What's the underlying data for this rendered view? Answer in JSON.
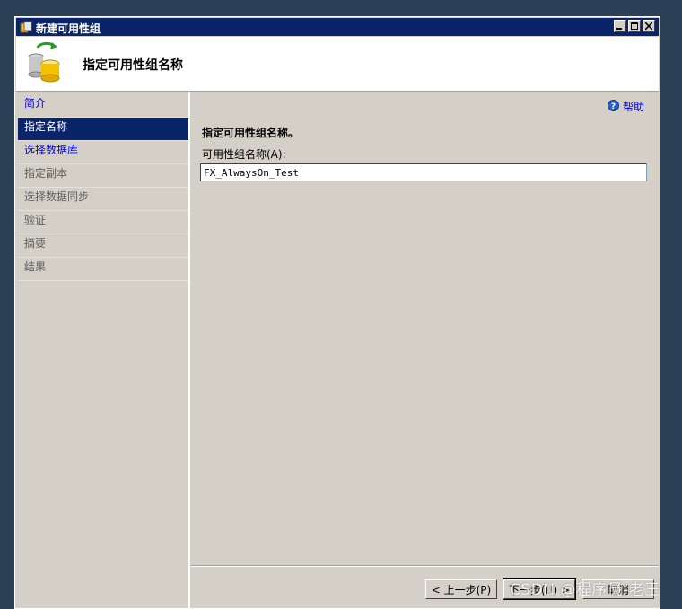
{
  "window": {
    "title": "新建可用性组",
    "controls": [
      "minimize",
      "maximize",
      "close"
    ]
  },
  "header": {
    "title": "指定可用性组名称",
    "icon": "database-sync-icon"
  },
  "sidebar": {
    "items": [
      {
        "label": "简介",
        "state": "link"
      },
      {
        "label": "指定名称",
        "state": "active"
      },
      {
        "label": "选择数据库",
        "state": "link"
      },
      {
        "label": "指定副本",
        "state": "disabled"
      },
      {
        "label": "选择数据同步",
        "state": "disabled"
      },
      {
        "label": "验证",
        "state": "disabled"
      },
      {
        "label": "摘要",
        "state": "disabled"
      },
      {
        "label": "结果",
        "state": "disabled"
      }
    ]
  },
  "content": {
    "help_label": "帮助",
    "section_title": "指定可用性组名称。",
    "field_label": "可用性组名称(A):",
    "field_value": "FX_AlwaysOn_Test"
  },
  "footer": {
    "prev_label": "< 上一步(P)",
    "next_label": "下一步(N) >",
    "cancel_label": "取消"
  },
  "watermark": "CSDN @程序员-老王",
  "colors": {
    "title_bar": "#0a246a",
    "active_item": "#0a246a",
    "link": "#0000ee",
    "panel": "#d4d0c8"
  }
}
